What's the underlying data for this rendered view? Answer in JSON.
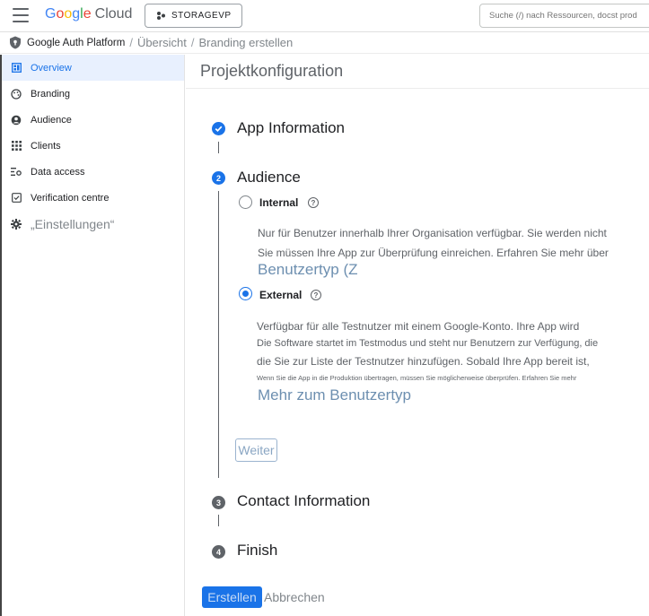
{
  "header": {
    "logo_google": [
      "G",
      "o",
      "o",
      "g",
      "l",
      "e"
    ],
    "logo_cloud": "Cloud",
    "project_label": "STORAGEVP",
    "search_placeholder": "Suche (/) nach Ressourcen, docst prod"
  },
  "breadcrumb": {
    "root": "Google Auth Platform",
    "items": [
      "Übersicht",
      "Branding erstellen"
    ]
  },
  "sidebar": {
    "items": [
      {
        "label": "Overview",
        "icon": "dashboard-icon",
        "active": true
      },
      {
        "label": "Branding",
        "icon": "palette-icon"
      },
      {
        "label": "Audience",
        "icon": "person-icon"
      },
      {
        "label": "Clients",
        "icon": "grid-icon"
      },
      {
        "label": "Data access",
        "icon": "data-access-icon"
      },
      {
        "label": "Verification centre",
        "icon": "checkbox-icon"
      },
      {
        "label": "„Einstellungen“",
        "icon": "gear-icon"
      }
    ]
  },
  "main": {
    "title": "Projektkonfiguration",
    "steps": [
      {
        "number": "✓",
        "label": "App Information",
        "state": "done"
      },
      {
        "number": "2",
        "label": "Audience",
        "state": "current"
      },
      {
        "number": "3",
        "label": "Contact Information",
        "state": "todo"
      },
      {
        "number": "4",
        "label": "Finish",
        "state": "todo"
      }
    ],
    "audience": {
      "internal": {
        "label": "Internal",
        "help": "?",
        "desc_line1": "Nur für Benutzer innerhalb Ihrer Organisation verfügbar. Sie werden nicht",
        "desc_line2": "Sie müssen Ihre App zur Überprüfung einreichen. Erfahren Sie mehr über",
        "link": "Benutzertyp (Z"
      },
      "external": {
        "label": "External",
        "help": "?",
        "selected": true,
        "desc_line1": "Verfügbar für alle Testnutzer mit einem Google-Konto. Ihre App wird",
        "desc_line2": "Die Software startet im Testmodus und steht nur Benutzern zur Verfügung, die",
        "desc_line3": "die Sie zur Liste der Testnutzer hinzufügen. Sobald Ihre App bereit ist,",
        "desc_line4": "Wenn Sie die App in die Produktion übertragen, müssen Sie möglicherweise überprüfen. Erfahren Sie mehr",
        "link": "Mehr zum Benutzertyp"
      },
      "next_button": "Weiter"
    },
    "create_button": "Erstellen",
    "cancel_button": "Abbrechen"
  },
  "colors": {
    "accent": "#1a73e8",
    "active_bg": "#e8f0fe",
    "link": "#6d8fb0"
  }
}
